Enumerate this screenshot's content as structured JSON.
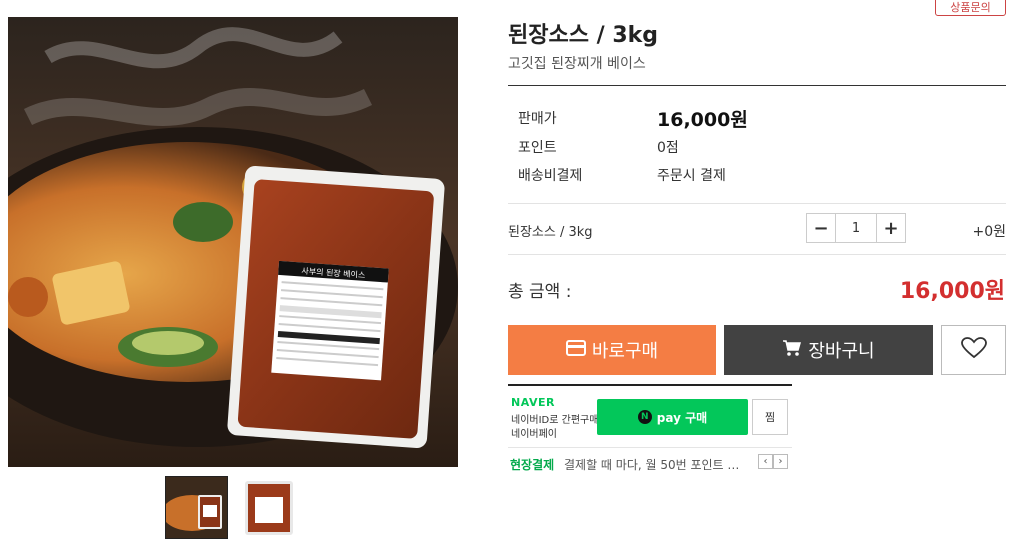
{
  "product": {
    "title": "된장소스 / 3kg",
    "subtitle": "고깃집 된장찌개 베이스"
  },
  "top_button": {
    "label": "상품문의"
  },
  "package": {
    "label_title": "사부의 된장 베이스"
  },
  "specs": [
    {
      "label": "판매가",
      "value": "16,000원"
    },
    {
      "label": "포인트",
      "value": "0점"
    },
    {
      "label": "배송비결제",
      "value": "주문시 결제"
    }
  ],
  "option": {
    "name": "된장소스 / 3kg",
    "quantity": "1",
    "minus_symbol": "−",
    "plus_symbol": "+",
    "price": "+0원"
  },
  "total": {
    "label": "총 금액 :",
    "value": "16,000원"
  },
  "buttons": {
    "buy": "바로구매",
    "cart": "장바구니"
  },
  "naverpay": {
    "logo": "NAVER",
    "line1": "네이버ID로 간편구매",
    "line2": "네이버페이",
    "pay_n": "N",
    "pay_label": "pay 구매",
    "zzim": "찜",
    "promo_head": "현장결제",
    "promo_text": "결제할 때 마다, 월 50번 포인트 …",
    "prev": "‹",
    "next": "›"
  },
  "colors": {
    "buy": "#f47d44",
    "cart": "#424242",
    "total_price": "#d32f2f",
    "naver_green": "#03c75a"
  },
  "icons": [
    "card-icon",
    "cart-icon",
    "heart-icon"
  ]
}
